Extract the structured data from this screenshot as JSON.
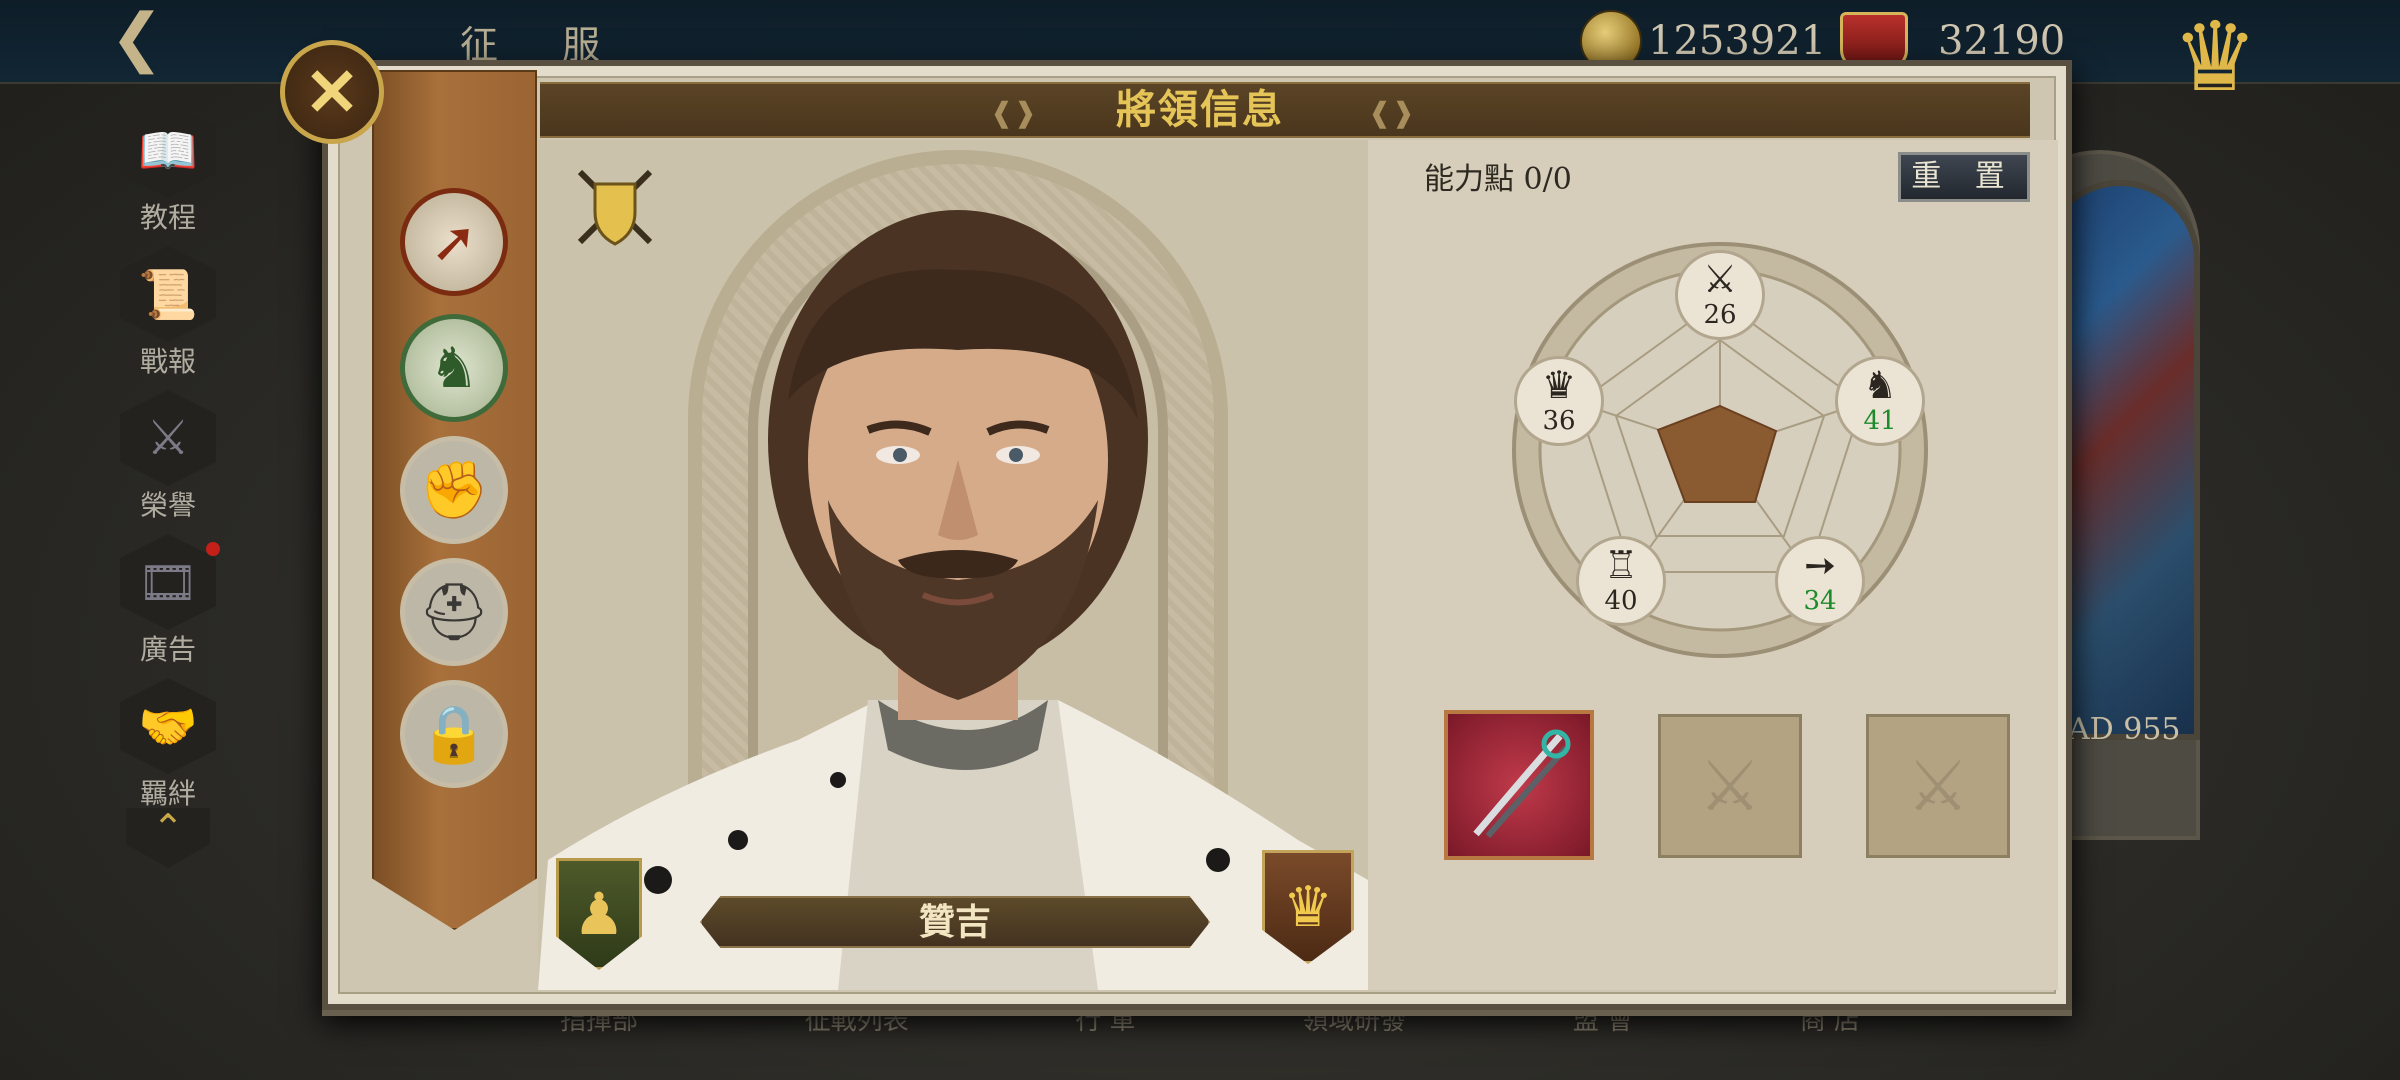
{
  "topbar": {
    "title": "征 服",
    "gold": "1253921",
    "honor": "32190"
  },
  "background": {
    "ad_label": "AD 955",
    "bottom_labels": [
      "指揮部",
      "征戰列表",
      "行 軍",
      "領域研發",
      "盟 會",
      "商 店"
    ]
  },
  "sidebar": {
    "items": [
      {
        "label": "教程",
        "icon": "book-icon"
      },
      {
        "label": "戰報",
        "icon": "scroll-icon"
      },
      {
        "label": "榮譽",
        "icon": "sword-hand-icon"
      },
      {
        "label": "廣告",
        "icon": "film-icon"
      },
      {
        "label": "羈絆",
        "icon": "handshake-icon"
      }
    ]
  },
  "panel": {
    "title": "將領信息",
    "points_label": "能力點 0/0",
    "reset_label": "重 置"
  },
  "general": {
    "name": "贊吉"
  },
  "tabs": [
    {
      "icon": "arrow-icon",
      "active": true
    },
    {
      "icon": "horse-icon",
      "active": false
    },
    {
      "icon": "fist-icon",
      "active": false
    },
    {
      "icon": "helmet-icon",
      "active": false
    },
    {
      "icon": "lock-icon",
      "active": false
    }
  ],
  "stats": {
    "attack": "26",
    "cavalry": "41",
    "archery": "34",
    "defense": "40",
    "leadership": "36"
  },
  "colors": {
    "accent_gold": "#e6c558",
    "stat_boost_green": "#1d8a2c",
    "radar_fill": "#8a5a30"
  }
}
